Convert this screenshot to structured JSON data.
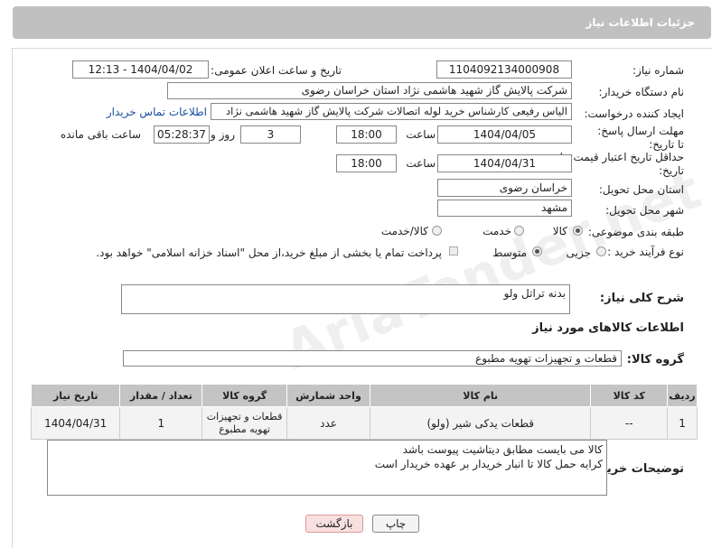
{
  "header": {
    "title": "جزئیات اطلاعات نیاز"
  },
  "labels": {
    "need_number": "شماره نیاز:",
    "announce_datetime": "تاریخ و ساعت اعلان عمومی:",
    "buyer_org": "نام دستگاه خریدار:",
    "requester": "ایجاد کننده درخواست:",
    "reply_deadline": "مهلت ارسال پاسخ: تا تاریخ:",
    "price_validity": "حداقل تاریخ اعتبار قیمت: تا تاریخ:",
    "time": "ساعت",
    "day_and": "روز و",
    "remaining": "ساعت باقی مانده",
    "delivery_province": "استان محل تحویل:",
    "delivery_city": "شهر محل تحویل:",
    "category": "طبقه بندی موضوعی:",
    "process_type": "نوع فرآیند خرید :",
    "description": "شرح کلی نیاز:",
    "goods_info": "اطلاعات کالاهای مورد نیاز",
    "goods_group": "گروه کالا:",
    "buyer_notes": "توضیحات خریدار:"
  },
  "fields": {
    "need_number": "1104092134000908",
    "announce_datetime": "1404/04/02 - 12:13",
    "buyer_org": "شرکت پالایش گاز شهید هاشمی نژاد   استان خراسان رضوی",
    "requester": "الیاس رفیعی کارشناس خرید لوله اتصالات شرکت پالایش گاز شهید هاشمی نژاد",
    "contact_link": "اطلاعات تماس خریدار",
    "reply_date": "1404/04/05",
    "reply_time": "18:00",
    "days": "3",
    "remaining_time": "05:28:37",
    "validity_date": "1404/04/31",
    "validity_time": "18:00",
    "province": "خراسان رضوی",
    "city": "مشهد",
    "description": "بدنه تراتل ولو",
    "goods_group": "قطعات و تجهیزات تهویه مطبوع",
    "buyer_notes_1": "کالا می بایست مطابق دیتاشیت پیوست باشد",
    "buyer_notes_2": "کرایه حمل کالا تا انبار خریدار بر عهده خریدار است"
  },
  "category_options": {
    "goods": "کالا",
    "service": "خدمت",
    "goods_service": "کالا/خدمت",
    "selected": "کالا"
  },
  "process_options": {
    "minor": "جزیی",
    "medium": "متوسط",
    "selected": "متوسط"
  },
  "payment_note": "پرداخت تمام یا بخشی از مبلغ خرید،از محل \"اسناد خزانه اسلامی\" خواهد بود.",
  "table": {
    "headers": [
      "ردیف",
      "کد کالا",
      "نام کالا",
      "واحد شمارش",
      "گروه کالا",
      "تعداد / مقدار",
      "تاریخ نیاز"
    ],
    "rows": [
      [
        "1",
        "--",
        "قطعات یدکی شیر (ولو)",
        "عدد",
        "قطعات و تجهیزات تهویه مطبوع",
        "1",
        "1404/04/31"
      ]
    ]
  },
  "buttons": {
    "print": "چاپ",
    "back": "بازگشت"
  },
  "watermark": "AriaTender.net"
}
